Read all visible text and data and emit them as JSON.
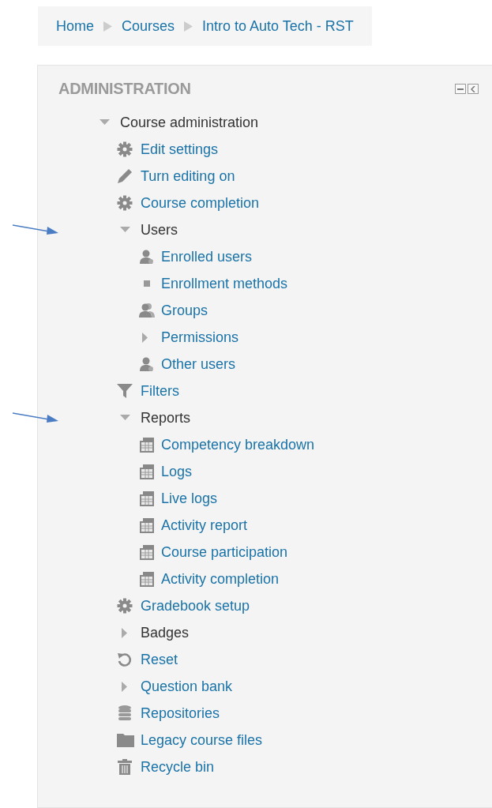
{
  "breadcrumb": [
    {
      "label": "Home"
    },
    {
      "label": "Courses"
    },
    {
      "label": "Intro to Auto Tech - RST"
    }
  ],
  "block": {
    "title": "ADMINISTRATION",
    "items": [
      {
        "kind": "branch",
        "label": "Course administration",
        "expanded": true,
        "link": false,
        "annotated": false,
        "children": [
          {
            "kind": "gear",
            "label": "Edit settings"
          },
          {
            "kind": "pencil",
            "label": "Turn editing on"
          },
          {
            "kind": "gear",
            "label": "Course completion"
          },
          {
            "kind": "branch",
            "label": "Users",
            "expanded": true,
            "link": false,
            "annotated": true,
            "children": [
              {
                "kind": "user",
                "label": "Enrolled users"
              },
              {
                "kind": "bullet",
                "label": "Enrollment methods"
              },
              {
                "kind": "group",
                "label": "Groups"
              },
              {
                "kind": "branch",
                "label": "Permissions",
                "expanded": false,
                "link": true,
                "annotated": false
              },
              {
                "kind": "user",
                "label": "Other users"
              }
            ]
          },
          {
            "kind": "filter",
            "label": "Filters"
          },
          {
            "kind": "branch",
            "label": "Reports",
            "expanded": true,
            "link": false,
            "annotated": true,
            "children": [
              {
                "kind": "report",
                "label": "Competency breakdown"
              },
              {
                "kind": "report",
                "label": "Logs"
              },
              {
                "kind": "report",
                "label": "Live logs"
              },
              {
                "kind": "report",
                "label": "Activity report"
              },
              {
                "kind": "report",
                "label": "Course participation"
              },
              {
                "kind": "report",
                "label": "Activity completion"
              }
            ]
          },
          {
            "kind": "gear",
            "label": "Gradebook setup"
          },
          {
            "kind": "branch",
            "label": "Badges",
            "expanded": false,
            "link": false,
            "annotated": false
          },
          {
            "kind": "reset",
            "label": "Reset"
          },
          {
            "kind": "branch",
            "label": "Question bank",
            "expanded": false,
            "link": true,
            "annotated": false
          },
          {
            "kind": "database",
            "label": "Repositories"
          },
          {
            "kind": "folder",
            "label": "Legacy course files"
          },
          {
            "kind": "trash",
            "label": "Recycle bin"
          }
        ]
      }
    ]
  }
}
